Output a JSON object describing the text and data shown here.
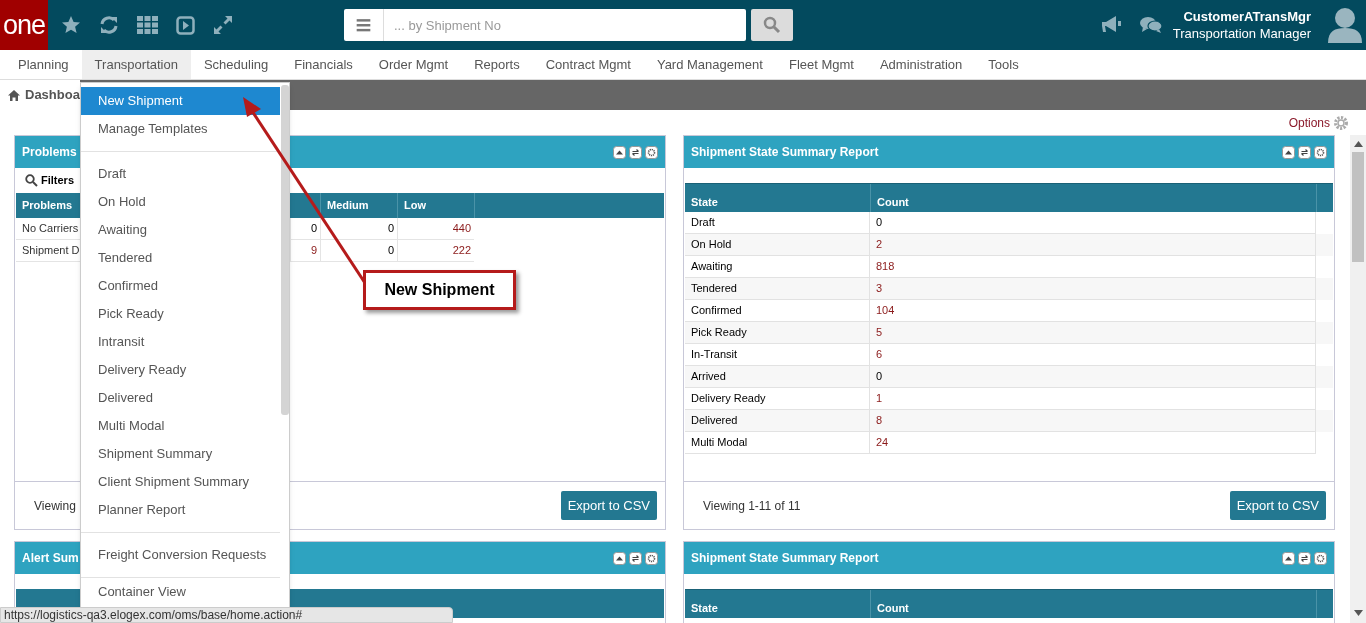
{
  "header": {
    "logo": "one",
    "search": {
      "placeholder": "... by Shipment No"
    },
    "user": {
      "name": "CustomerATransMgr",
      "role": "Transportation Manager"
    }
  },
  "nav": [
    {
      "label": "Planning",
      "selected": false
    },
    {
      "label": "Transportation",
      "selected": true
    },
    {
      "label": "Scheduling",
      "selected": false
    },
    {
      "label": "Financials",
      "selected": false
    },
    {
      "label": "Order Mgmt",
      "selected": false
    },
    {
      "label": "Reports",
      "selected": false
    },
    {
      "label": "Contract Mgmt",
      "selected": false
    },
    {
      "label": "Yard Management",
      "selected": false
    },
    {
      "label": "Fleet Mgmt",
      "selected": false
    },
    {
      "label": "Administration",
      "selected": false
    },
    {
      "label": "Tools",
      "selected": false
    }
  ],
  "breadcrumb": "Dashboa",
  "options_link": "Options",
  "panels": [
    {
      "kind": "problems",
      "title": "Problems",
      "filters": "Filters",
      "name_column": "Problems",
      "value_columns": [
        {},
        {
          "label": "Medium"
        },
        {
          "label": "Low"
        }
      ],
      "rows": [
        {
          "name": "No Carriers",
          "cells": [
            {
              "text": "0",
              "linked": false
            },
            {
              "text": "0",
              "linked": false
            },
            {
              "text": "440",
              "linked": true
            }
          ]
        },
        {
          "name": "Shipment D",
          "cells": [
            {
              "text": "9",
              "linked": true
            },
            {
              "text": "0",
              "linked": false
            },
            {
              "text": "222",
              "linked": true
            }
          ]
        }
      ],
      "footer": "Viewing",
      "button": "Export to CSV"
    },
    {
      "kind": "state_summary",
      "title": "Shipment State Summary Report",
      "columns": [
        "State",
        "Count"
      ],
      "rows": [
        {
          "state": "Draft",
          "count": "0",
          "linked": false
        },
        {
          "state": "On Hold",
          "count": "2",
          "linked": true
        },
        {
          "state": "Awaiting",
          "count": "818",
          "linked": true
        },
        {
          "state": "Tendered",
          "count": "3",
          "linked": true
        },
        {
          "state": "Confirmed",
          "count": "104",
          "linked": true
        },
        {
          "state": "Pick Ready",
          "count": "5",
          "linked": true
        },
        {
          "state": "In-Transit",
          "count": "6",
          "linked": true
        },
        {
          "state": "Arrived",
          "count": "0",
          "linked": false
        },
        {
          "state": "Delivery Ready",
          "count": "1",
          "linked": true
        },
        {
          "state": "Delivered",
          "count": "8",
          "linked": true
        },
        {
          "state": "Multi Modal",
          "count": "24",
          "linked": true
        }
      ],
      "footer": "Viewing 1-11 of 11",
      "button": "Export to CSV"
    },
    {
      "kind": "alerts",
      "title": "Alert Sum"
    },
    {
      "kind": "state_summary",
      "title": "Shipment State Summary Report",
      "columns": [
        "State",
        "Count"
      ]
    }
  ],
  "dropdown": {
    "groups": [
      [
        {
          "label": "New Shipment",
          "selected": true
        },
        {
          "label": "Manage Templates",
          "selected": false
        }
      ],
      [
        {
          "label": "Draft",
          "selected": false
        },
        {
          "label": "On Hold",
          "selected": false
        },
        {
          "label": "Awaiting",
          "selected": false
        },
        {
          "label": "Tendered",
          "selected": false
        },
        {
          "label": "Confirmed",
          "selected": false
        },
        {
          "label": "Pick Ready",
          "selected": false
        },
        {
          "label": "Intransit",
          "selected": false
        },
        {
          "label": "Delivery Ready",
          "selected": false
        },
        {
          "label": "Delivered",
          "selected": false
        },
        {
          "label": "Multi Modal",
          "selected": false
        },
        {
          "label": "Shipment Summary",
          "selected": false
        },
        {
          "label": "Client Shipment Summary",
          "selected": false
        },
        {
          "label": "Planner Report",
          "selected": false
        }
      ],
      [
        {
          "label": "Freight Conversion Requests",
          "selected": false
        }
      ],
      [
        {
          "label": "Container View",
          "selected": false
        }
      ]
    ]
  },
  "callout": "New Shipment",
  "status_bar": "https://logistics-qa3.elogex.com/oms/base/home.action#"
}
